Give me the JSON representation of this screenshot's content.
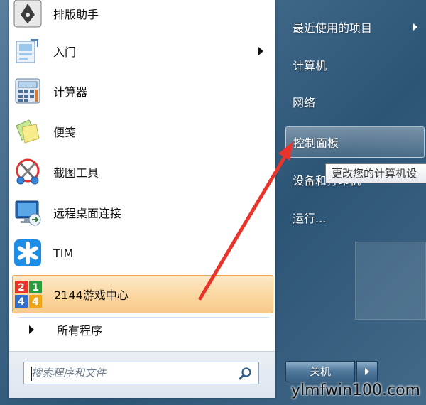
{
  "programs": [
    {
      "label": "排版助手",
      "icon": "pen-nib-icon",
      "has_submenu": false
    },
    {
      "label": "入门",
      "icon": "getting-started-icon",
      "has_submenu": true
    },
    {
      "label": "计算器",
      "icon": "calculator-icon",
      "has_submenu": false
    },
    {
      "label": "便笺",
      "icon": "sticky-notes-icon",
      "has_submenu": false
    },
    {
      "label": "截图工具",
      "icon": "scissors-icon",
      "has_submenu": false
    },
    {
      "label": "远程桌面连接",
      "icon": "remote-desktop-icon",
      "has_submenu": false
    },
    {
      "label": "TIM",
      "icon": "tim-star-icon",
      "has_submenu": false
    },
    {
      "label": "2144游戏中心",
      "icon": "game-center-2144-icon",
      "has_submenu": false,
      "highlighted": true
    }
  ],
  "all_programs": "所有程序",
  "search": {
    "placeholder": "搜索程序和文件"
  },
  "game_icon_digits": [
    "2",
    "1",
    "4",
    "4"
  ],
  "right_menu": [
    {
      "label": "最近使用的项目",
      "has_submenu": true
    },
    {
      "label": "计算机"
    },
    {
      "label": "网络"
    },
    {
      "label": "控制面板",
      "highlighted": true
    },
    {
      "label": "设备和打印机"
    },
    {
      "label": "运行..."
    }
  ],
  "tooltip": "更改您的计算机设",
  "shutdown_label": "关机",
  "watermark": "ylmfwin100.com",
  "colors": {
    "accent_orange": "#f8c98a",
    "arrow_red": "#e8342b"
  }
}
